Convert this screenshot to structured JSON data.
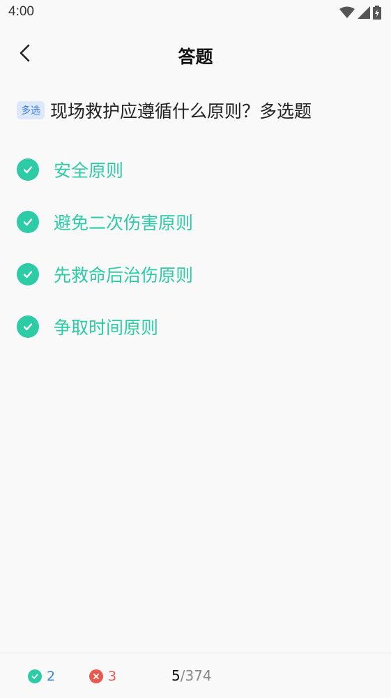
{
  "status_bar": {
    "time": "4:00",
    "icons": [
      "wifi-icon",
      "signal-icon",
      "battery-icon"
    ]
  },
  "header": {
    "title": "答题",
    "back_icon": "chevron-left-icon"
  },
  "question": {
    "badge": "多选",
    "text": "现场救护应遵循什么原则？多选题"
  },
  "options": [
    {
      "label": "安全原则",
      "checked": true
    },
    {
      "label": "避免二次伤害原则",
      "checked": true
    },
    {
      "label": "先救命后治伤原则",
      "checked": true
    },
    {
      "label": "争取时间原则",
      "checked": true
    }
  ],
  "footer": {
    "correct_count": "2",
    "wrong_count": "3",
    "current": "5",
    "separator": "/",
    "total": "374"
  },
  "colors": {
    "accent": "#2dcca7",
    "correct": "#2e86de",
    "wrong": "#e85a4f",
    "badge_bg": "#dde9fb",
    "badge_text": "#3d7be0"
  }
}
